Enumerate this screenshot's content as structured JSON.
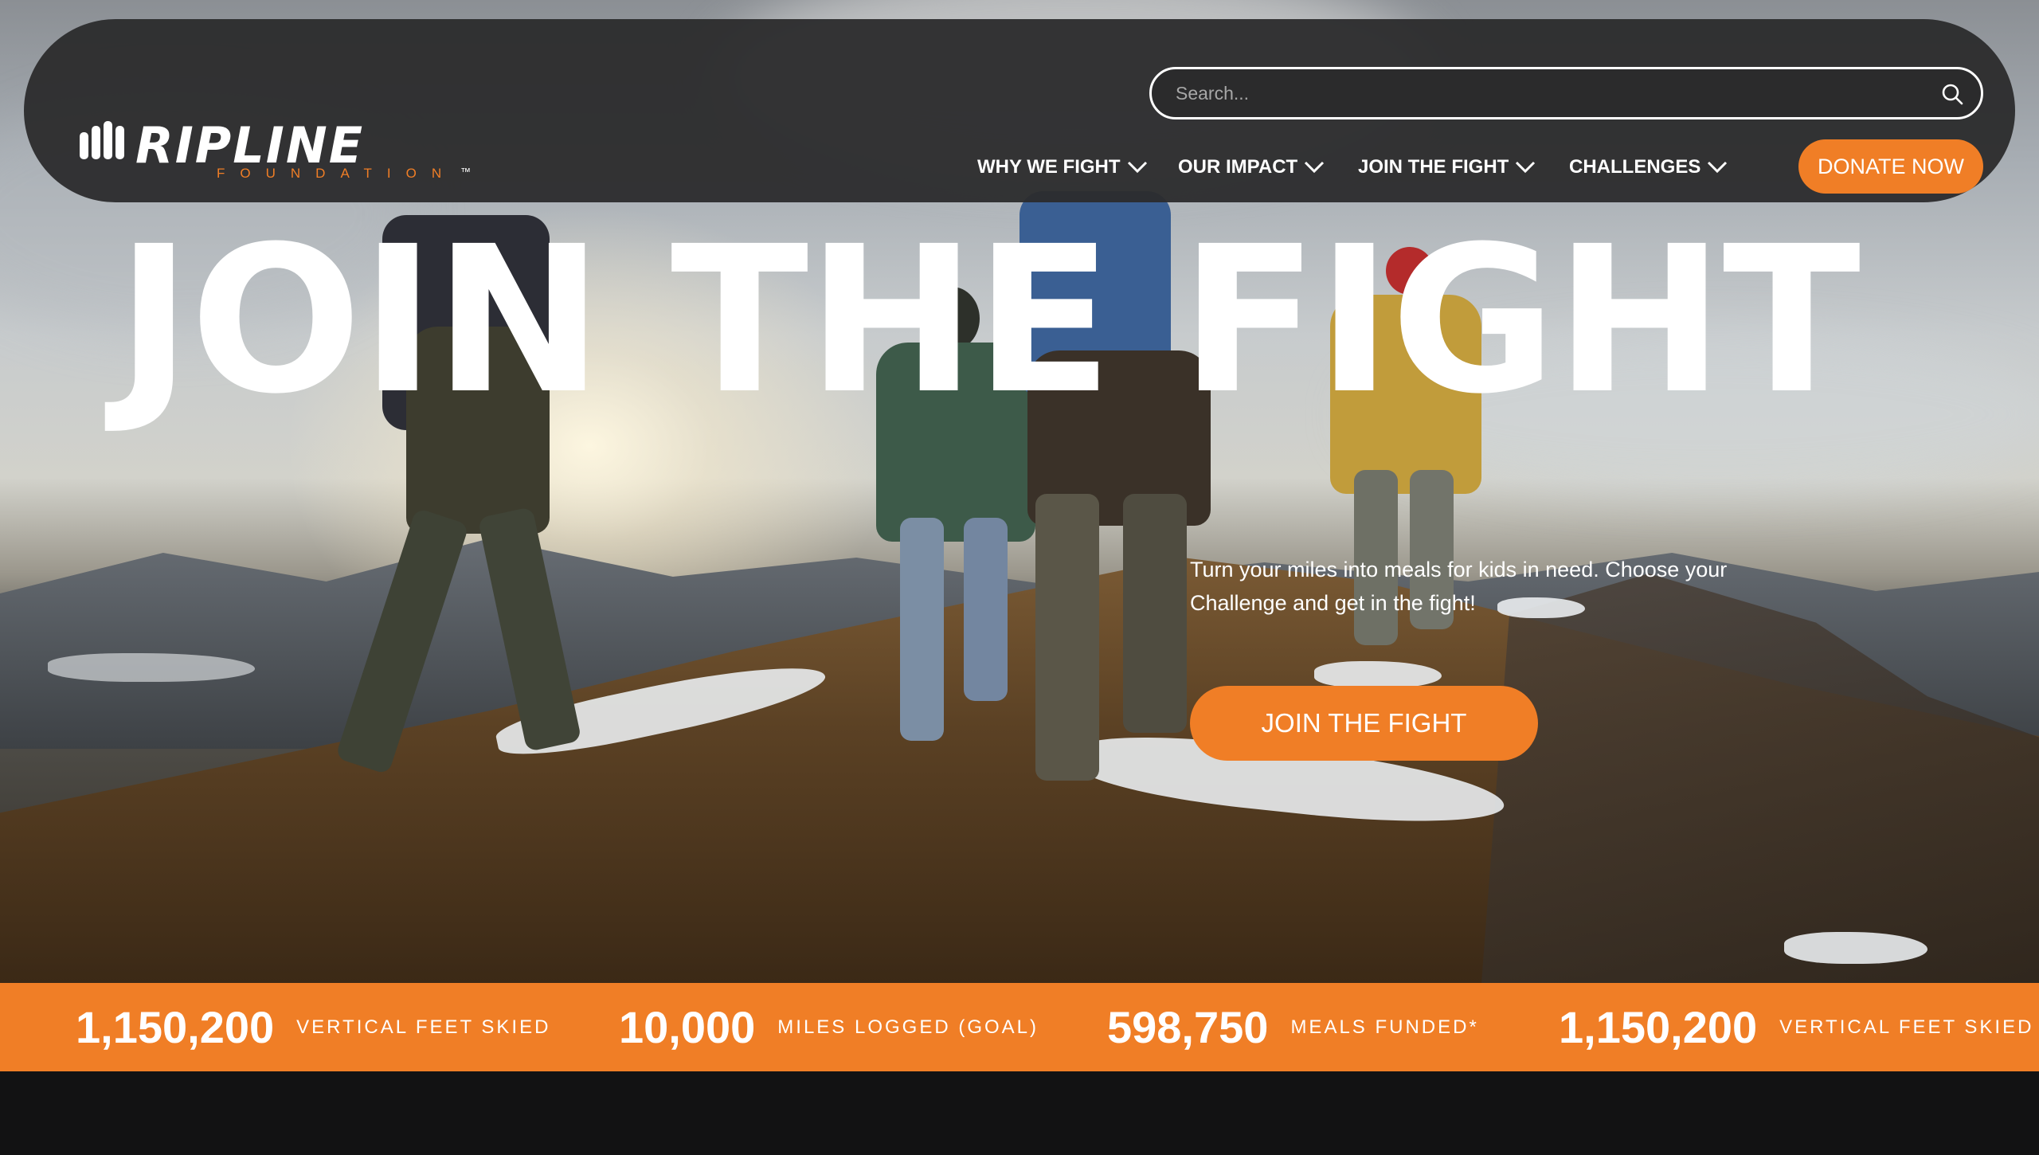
{
  "brand": {
    "name": "RIPLINE",
    "sub": "FOUNDATION",
    "tm": "™",
    "accent": "#f07e26"
  },
  "search": {
    "placeholder": "Search...",
    "icon": "search-icon"
  },
  "nav": {
    "items": [
      {
        "label": "WHY WE FIGHT"
      },
      {
        "label": "OUR IMPACT"
      },
      {
        "label": "JOIN THE FIGHT"
      },
      {
        "label": "CHALLENGES"
      }
    ],
    "donate_label": "DONATE NOW"
  },
  "hero": {
    "headline": "JOIN THE FIGHT",
    "subtext": "Turn your miles into meals for kids in need. Choose your Challenge and get in the fight!",
    "cta_label": "JOIN THE FIGHT"
  },
  "stats": [
    {
      "value": "1,150,200",
      "label": "VERTICAL FEET SKIED"
    },
    {
      "value": "10,000",
      "label": "MILES LOGGED (GOAL)"
    },
    {
      "value": "598,750",
      "label": "MEALS FUNDED*"
    },
    {
      "value": "1,150,200",
      "label": "VERTICAL FEET SKIED"
    }
  ]
}
